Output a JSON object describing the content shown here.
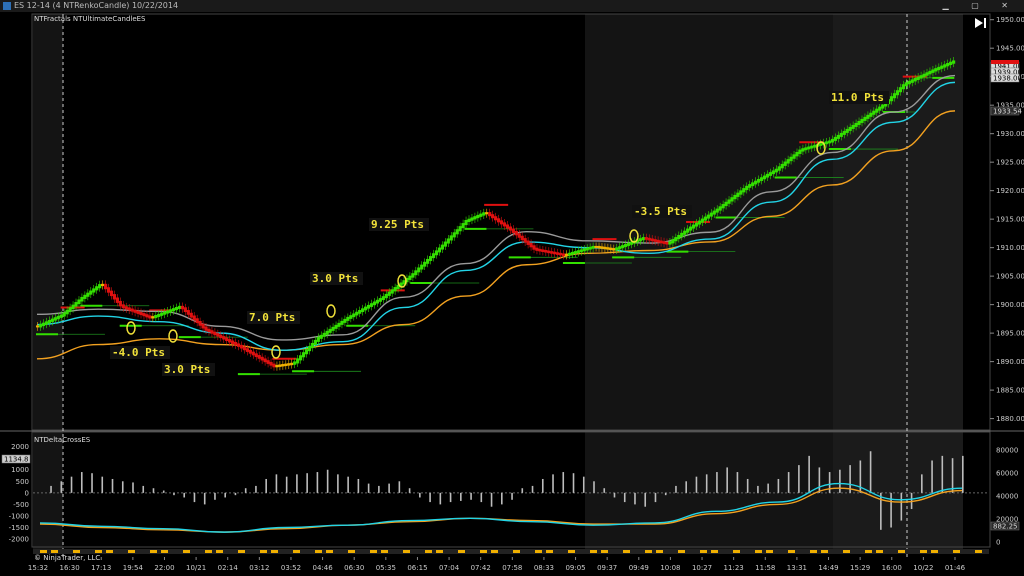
{
  "window": {
    "title": "ES 12-14 (4 NTRenkoCandle)  10/22/2014"
  },
  "indicators": {
    "price_panel": "NTFractals  NTUltimateCandleES",
    "lower_panel": "NTDeltaCrossES",
    "footer": "© NinjaTrader, LLC"
  },
  "colors": {
    "bull": "#33e000",
    "bear": "#e01010",
    "neutral": "#f0b000",
    "cyan": "#22d4e6",
    "orange": "#f2a120",
    "gray": "#9a9a9a",
    "annotation": "#f2e23a",
    "session_shade": "#1b1b1b"
  },
  "chart_data": [
    {
      "type": "candlestick",
      "title": "",
      "x_ticks": [
        "15:32",
        "16:30",
        "17:13",
        "19:54",
        "22:00",
        "10/21",
        "02:14",
        "03:12",
        "03:52",
        "04:46",
        "06:30",
        "05:35",
        "06:15",
        "07:04",
        "07:42",
        "07:58",
        "08:33",
        "09:05",
        "09:37",
        "09:49",
        "10:08",
        "10:27",
        "11:23",
        "11:58",
        "13:31",
        "14:49",
        "15:29",
        "16:00",
        "10/22",
        "01:46"
      ],
      "y_ticks": [
        1880.0,
        1885.0,
        1890.0,
        1895.0,
        1900.0,
        1905.0,
        1910.0,
        1915.0,
        1920.0,
        1925.0,
        1930.0,
        1935.0,
        1940.0,
        1945.0,
        1950.0
      ],
      "ylim": [
        1878,
        1951
      ],
      "price_labels": [
        "1941.00",
        "1939.00",
        "1938.00",
        "1933.54"
      ],
      "price_path": [
        {
          "x": 0,
          "v": 1896.0
        },
        {
          "x": 5,
          "v": 1898.0
        },
        {
          "x": 9,
          "v": 1901.0
        },
        {
          "x": 13,
          "v": 1903.5
        },
        {
          "x": 17,
          "v": 1899.5
        },
        {
          "x": 23,
          "v": 1897.5
        },
        {
          "x": 29,
          "v": 1899.5
        },
        {
          "x": 34,
          "v": 1895.5
        },
        {
          "x": 41,
          "v": 1892.5
        },
        {
          "x": 48,
          "v": 1889.0
        },
        {
          "x": 52,
          "v": 1889.5
        },
        {
          "x": 57,
          "v": 1894.0
        },
        {
          "x": 63,
          "v": 1897.5
        },
        {
          "x": 70,
          "v": 1901.0
        },
        {
          "x": 76,
          "v": 1905.0
        },
        {
          "x": 82,
          "v": 1910.0
        },
        {
          "x": 87,
          "v": 1914.5
        },
        {
          "x": 91,
          "v": 1916.0
        },
        {
          "x": 96,
          "v": 1913.0
        },
        {
          "x": 101,
          "v": 1909.5
        },
        {
          "x": 107,
          "v": 1908.5
        },
        {
          "x": 113,
          "v": 1910.0
        },
        {
          "x": 117,
          "v": 1909.5
        },
        {
          "x": 123,
          "v": 1911.5
        },
        {
          "x": 128,
          "v": 1910.5
        },
        {
          "x": 132,
          "v": 1913.0
        },
        {
          "x": 138,
          "v": 1916.5
        },
        {
          "x": 144,
          "v": 1920.5
        },
        {
          "x": 150,
          "v": 1923.5
        },
        {
          "x": 155,
          "v": 1927.0
        },
        {
          "x": 161,
          "v": 1928.5
        },
        {
          "x": 167,
          "v": 1932.0
        },
        {
          "x": 172,
          "v": 1935.0
        },
        {
          "x": 176,
          "v": 1938.5
        },
        {
          "x": 182,
          "v": 1941.0
        },
        {
          "x": 186,
          "v": 1942.5
        }
      ],
      "ma_cyan": [
        1896.5,
        1898.0,
        1897.0,
        1895.0,
        1892.0,
        1893.5,
        1899.5,
        1906.0,
        1911.0,
        1910.0,
        1909.0,
        1911.5,
        1918.0,
        1925.5,
        1932.0,
        1939.0
      ],
      "ma_orange": [
        1890.5,
        1893.0,
        1894.0,
        1893.0,
        1892.0,
        1893.0,
        1896.5,
        1901.5,
        1907.0,
        1909.0,
        1909.5,
        1911.0,
        1915.5,
        1921.0,
        1927.0,
        1934.0
      ],
      "annotations": [
        "-4.0 Pts",
        "3.0 Pts",
        "7.0 Pts",
        "3.0 Pts",
        "9.25 Pts",
        "-3.5 Pts",
        "11.0 Pts"
      ]
    },
    {
      "type": "histogram+line",
      "title": "NTDeltaCrossES",
      "left_ticks": [
        "2000",
        "1500",
        "1000",
        "500",
        "0",
        "-500",
        "-1000",
        "-1500",
        "-2000"
      ],
      "right_ticks": [
        "80000",
        "60000",
        "40000",
        "20000",
        "0"
      ],
      "value_labels": [
        "1134.8",
        "882.25"
      ],
      "histogram": [
        0,
        300,
        500,
        700,
        900,
        850,
        700,
        600,
        500,
        450,
        300,
        200,
        100,
        -100,
        -200,
        -400,
        -500,
        -300,
        -200,
        -100,
        200,
        300,
        600,
        800,
        700,
        800,
        850,
        900,
        1000,
        800,
        700,
        600,
        400,
        300,
        400,
        500,
        200,
        -200,
        -400,
        -500,
        -400,
        -350,
        -300,
        -400,
        -600,
        -500,
        -300,
        200,
        300,
        600,
        800,
        900,
        850,
        700,
        500,
        200,
        -200,
        -400,
        -500,
        -600,
        -400,
        -100,
        300,
        500,
        700,
        800,
        900,
        1100,
        900,
        600,
        300,
        400,
        600,
        900,
        1200,
        1600,
        1100,
        900,
        1000,
        1200,
        1400,
        1800,
        -1600,
        -1500,
        -1200,
        -700,
        800,
        1400,
        1600,
        1500,
        1600
      ],
      "lines_cyan": [
        -1300,
        -1450,
        -1550,
        -1700,
        -1500,
        -1400,
        -1200,
        -1100,
        -1250,
        -1400,
        -1300,
        -800,
        -400,
        400,
        -300,
        200
      ],
      "lines_orange": [
        -1350,
        -1500,
        -1600,
        -1700,
        -1550,
        -1400,
        -1250,
        -1100,
        -1200,
        -1350,
        -1350,
        -900,
        -500,
        200,
        -400,
        100
      ]
    }
  ]
}
